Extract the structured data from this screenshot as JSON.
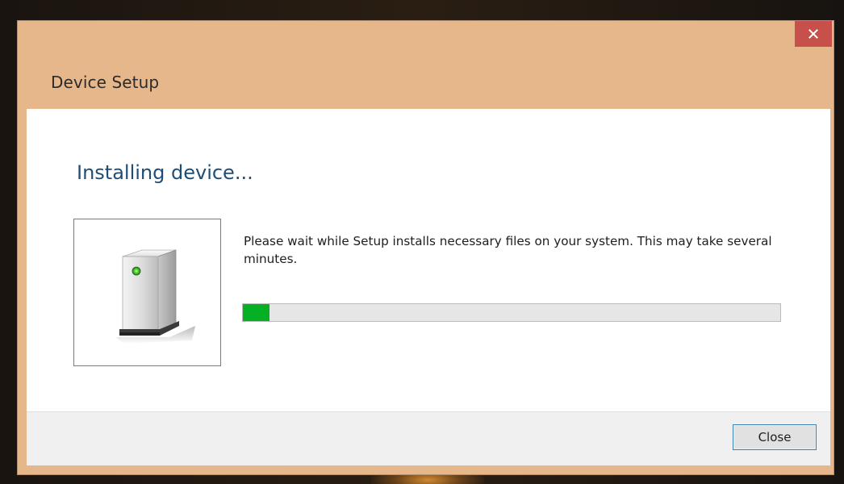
{
  "window": {
    "title": "Device Setup",
    "close_icon": "close-x-icon"
  },
  "content": {
    "heading": "Installing device...",
    "device_icon": "external-drive-icon",
    "message": "Please wait while Setup installs necessary files on your system. This may take several minutes.",
    "progress_fraction": 0.05
  },
  "footer": {
    "close_label": "Close"
  },
  "colors": {
    "title_bar": "#e6b78a",
    "close_x_button": "#c7504a",
    "heading": "#1e4e78",
    "progress_fill": "#06b025",
    "progress_track": "#e6e6e6"
  }
}
